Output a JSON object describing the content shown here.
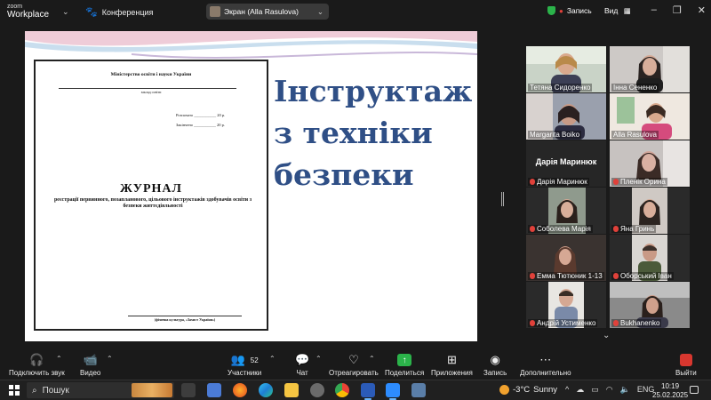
{
  "app": {
    "logo_line1": "zoom",
    "logo_line2": "Workplace"
  },
  "titlebar": {
    "conference_label": "Конференция",
    "screen_label": "Экран (Alla Rasulova)",
    "record_label": "Запись",
    "view_label": "Вид"
  },
  "shared_screen": {
    "journal": {
      "ministry": "Міністерство освіти і науки України",
      "institution": "заклад освіти",
      "started_label": "Розпочато",
      "started_year": "20 р.",
      "finished_label": "Закінчено",
      "finished_year": "20 р.",
      "title": "ЖУРНАЛ",
      "description": "реєстрації первинного, позапланового, цільового інструктажів здобувачів освіти з безпеки життєдіяльності",
      "footer": "(фізична культура, «Захист України»)"
    },
    "heading_lines": [
      "Інструктаж",
      "з техніки",
      "безпеки"
    ]
  },
  "participants": [
    {
      "name": "Тетяна Сидоренко",
      "muted": false,
      "video": true,
      "active": true
    },
    {
      "name": "Інна Сененко",
      "muted": false,
      "video": true
    },
    {
      "name": "Margarita Boiko",
      "muted": false,
      "video": true
    },
    {
      "name": "Alla Rasulova",
      "muted": false,
      "video": true
    },
    {
      "name": "Дарія Маринюк",
      "muted": true,
      "video": false,
      "big_name": "Дарія Маринюк"
    },
    {
      "name": "Пленік Орина",
      "muted": true,
      "video": true
    },
    {
      "name": "Соболева Марія",
      "muted": true,
      "video": true
    },
    {
      "name": "Яна Гринь",
      "muted": true,
      "video": true
    },
    {
      "name": "Емма Тютюник 1-13",
      "muted": true,
      "video": true
    },
    {
      "name": "Оборський Іван",
      "muted": true,
      "video": true
    },
    {
      "name": "Андрій Устименко",
      "muted": true,
      "video": true
    },
    {
      "name": "Bukhanenko",
      "muted": true,
      "video": true
    }
  ],
  "toolbar": {
    "audio": "Подключить звук",
    "video": "Видео",
    "participants": "Участники",
    "participants_count": "52",
    "chat": "Чат",
    "react": "Отреагировать",
    "share": "Поделиться",
    "apps": "Приложения",
    "record": "Запись",
    "more": "Дополнительно",
    "exit": "Выйти"
  },
  "taskbar": {
    "search_label": "Пошук",
    "weather_temp": "-3°C",
    "weather_text": "Sunny",
    "lang": "ENG",
    "time": "10:19",
    "date": "25.02.2025"
  },
  "colors": {
    "accent_green": "#2bb34a",
    "heading_blue": "#2f4f86",
    "exit_red": "#d8372f"
  }
}
